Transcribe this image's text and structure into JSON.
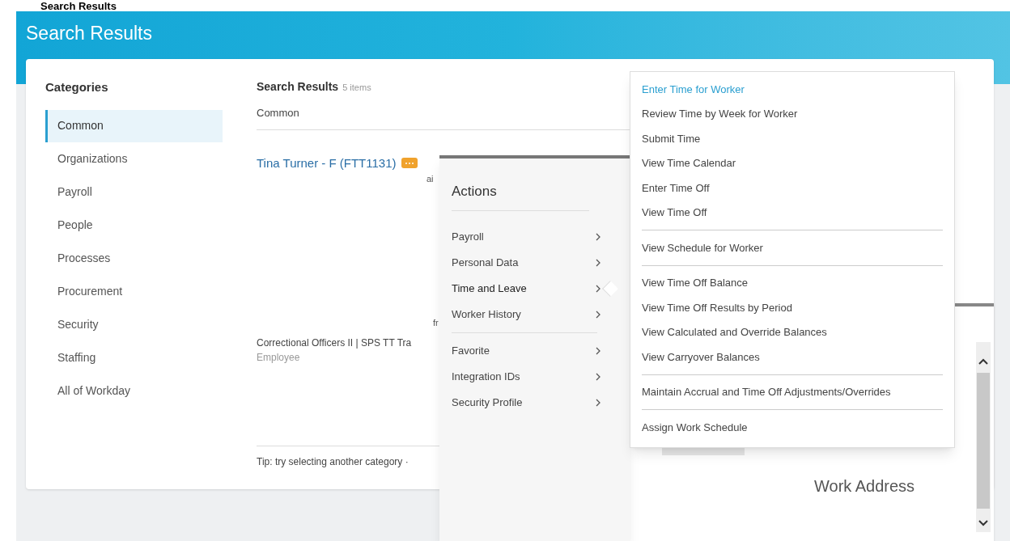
{
  "page_heading": "Search Results",
  "header": {
    "title": "Search Results"
  },
  "categories": {
    "title": "Categories",
    "items": [
      {
        "label": "Common",
        "selected": true
      },
      {
        "label": "Organizations",
        "selected": false
      },
      {
        "label": "Payroll",
        "selected": false
      },
      {
        "label": "People",
        "selected": false
      },
      {
        "label": "Processes",
        "selected": false
      },
      {
        "label": "Procurement",
        "selected": false
      },
      {
        "label": "Security",
        "selected": false
      },
      {
        "label": "Staffing",
        "selected": false
      },
      {
        "label": "All of Workday",
        "selected": false
      }
    ]
  },
  "results": {
    "title": "Search Results",
    "count": "5 items",
    "section": "Common",
    "worker_link": "Tina Turner - F (FTT1131)",
    "fragment_1": "ai",
    "fragment_2": "fr",
    "position": "Correctional Officers II | SPS TT Tra",
    "worker_type": "Employee",
    "tip": "Tip: try selecting another category ·"
  },
  "actions_menu": {
    "title": "Actions",
    "groups": [
      [
        {
          "label": "Payroll",
          "expanded": false
        },
        {
          "label": "Personal Data",
          "expanded": false
        },
        {
          "label": "Time and Leave",
          "expanded": true
        },
        {
          "label": "Worker History",
          "expanded": false
        }
      ],
      [
        {
          "label": "Favorite",
          "expanded": false
        },
        {
          "label": "Integration IDs",
          "expanded": false
        },
        {
          "label": "Security Profile",
          "expanded": false
        }
      ]
    ]
  },
  "submenu": {
    "groups": [
      [
        {
          "label": "Enter Time for Worker",
          "selected": true
        },
        {
          "label": "Review Time by Week for Worker",
          "selected": false
        },
        {
          "label": "Submit Time",
          "selected": false
        },
        {
          "label": "View Time Calendar",
          "selected": false
        },
        {
          "label": "Enter Time Off",
          "selected": false
        },
        {
          "label": "View Time Off",
          "selected": false
        }
      ],
      [
        {
          "label": "View Schedule for Worker",
          "selected": false
        }
      ],
      [
        {
          "label": "View Time Off Balance",
          "selected": false
        },
        {
          "label": "View Time Off Results by Period",
          "selected": false
        },
        {
          "label": "View Calculated and Override Balances",
          "selected": false
        },
        {
          "label": "View Carryover Balances",
          "selected": false
        }
      ],
      [
        {
          "label": "Maintain Accrual and Time Off Adjustments/Overrides",
          "selected": false
        }
      ],
      [
        {
          "label": "Assign Work Schedule",
          "selected": false
        }
      ]
    ]
  },
  "detail_panel": {
    "label": "Work Address"
  }
}
